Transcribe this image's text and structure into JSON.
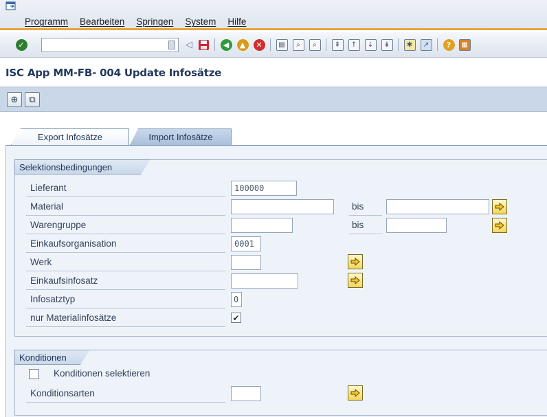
{
  "menu": {
    "items": [
      "Programm",
      "Bearbeiten",
      "Springen",
      "System",
      "Hilfe"
    ],
    "underline_letters": [
      "P",
      "B",
      "S",
      "y",
      "H"
    ]
  },
  "toolbar": {
    "command_field_value": "",
    "icons": [
      "enter-check-icon",
      "command-dropdown-icon",
      "back-arrow-icon",
      "save-icon",
      "back-icon",
      "exit-icon",
      "cancel-icon",
      "print-icon",
      "find-icon",
      "find-next-icon",
      "first-page-icon",
      "previous-page-icon",
      "next-page-icon",
      "last-page-icon",
      "new-session-icon",
      "shortcut-icon",
      "help-icon",
      "layout-menu-icon"
    ]
  },
  "page_title": "ISC App MM-FB- 004 Update Infosätze",
  "app_toolbar": {
    "icons": [
      "execute-icon",
      "get-variant-icon"
    ]
  },
  "tabs": [
    {
      "label": "Export Infosätze",
      "active": true
    },
    {
      "label": "Import Infosätze",
      "active": false
    }
  ],
  "selection": {
    "frame_title": "Selektionsbedingungen",
    "fields": [
      {
        "label": "Lieferant",
        "value": "100000"
      },
      {
        "label": "Material",
        "value": "",
        "to_label": "bis",
        "to_value": ""
      },
      {
        "label": "Warengruppe",
        "value": "",
        "to_label": "bis",
        "to_value": ""
      },
      {
        "label": "Einkaufsorganisation",
        "value": "0001"
      },
      {
        "label": "Werk",
        "value": ""
      },
      {
        "label": "Einkaufsinfosatz",
        "value": ""
      },
      {
        "label": "Infosatztyp",
        "value": "0"
      },
      {
        "label": "nur Materialinfosätze",
        "checked": true
      }
    ]
  },
  "conditions": {
    "frame_title": "Konditionen",
    "select_label": "Konditionen selektieren",
    "select_checked": false,
    "types_label": "Konditionsarten",
    "types_value": ""
  },
  "colors": {
    "accent_orange": "#e8a23a",
    "title_blue": "#23395d",
    "app_toolbar": "#c9d7e8",
    "background_panel": "#eef3f9",
    "arrow_button_yellow": "#f3d75c"
  }
}
